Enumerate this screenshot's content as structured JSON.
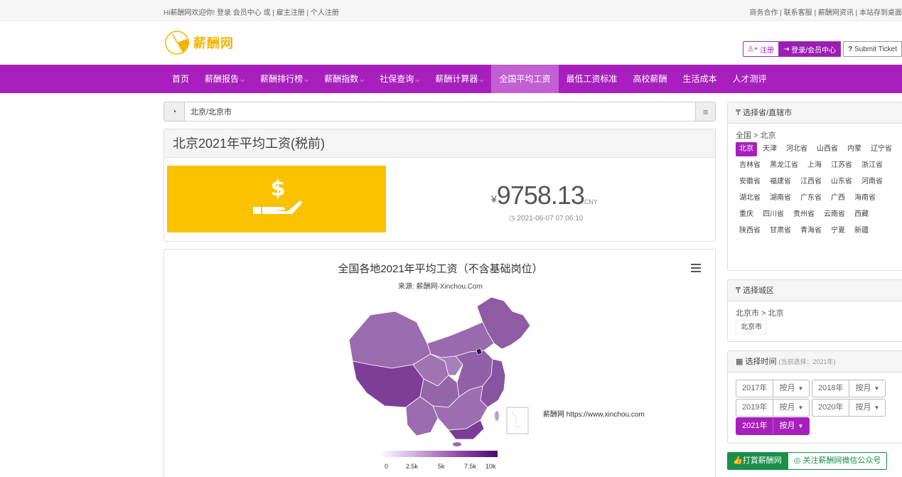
{
  "topbar": {
    "welcome": "Hi薪酬网欢迎你!",
    "login": "登录",
    "member_center": "会员中心",
    "or": "或",
    "employer_register": "雇主注册",
    "personal_register": "个人注册",
    "right_links": [
      "商务合作",
      "联系客服",
      "薪酬网资讯",
      "本站存到桌面"
    ]
  },
  "header": {
    "brand": "薪酬网",
    "register": "注册",
    "login_center": "登录/会员中心",
    "ticket": "Submit Ticket"
  },
  "nav": {
    "items": [
      {
        "label": "首页",
        "dropdown": false
      },
      {
        "label": "薪酬报告",
        "dropdown": true
      },
      {
        "label": "薪酬排行榜",
        "dropdown": true
      },
      {
        "label": "薪酬指数",
        "dropdown": true
      },
      {
        "label": "社保查询",
        "dropdown": true
      },
      {
        "label": "薪酬计算器",
        "dropdown": true
      },
      {
        "label": "全国平均工资",
        "dropdown": false,
        "active": true
      },
      {
        "label": "最低工资标准",
        "dropdown": false
      },
      {
        "label": "高校薪酬",
        "dropdown": false
      },
      {
        "label": "生活成本",
        "dropdown": false
      },
      {
        "label": "人才测评",
        "dropdown": false
      }
    ],
    "caret": "⌵"
  },
  "location": {
    "path": "北京/北京市"
  },
  "salary": {
    "title": "北京2021年平均工资(税前)",
    "currency_symbol": "¥",
    "amount": "9758.13",
    "unit": "CNY",
    "timestamp": "2021-06-07 07:06:10"
  },
  "chart_data": {
    "type": "heatmap",
    "title": "全国各地2021年平均工资（不含基础岗位）",
    "subtitle": "来源: 薪酬网-Xinchou.Com",
    "credit": "薪酬网 https://www.xinchou.com",
    "color_axis": {
      "min": 0,
      "max": 10000,
      "ticks": [
        "0",
        "2.5k",
        "5k",
        "7.5k",
        "10k"
      ],
      "colors": [
        "#fbf7fc",
        "#4a0d6b"
      ]
    }
  },
  "sidebar": {
    "province": {
      "heading": "选择省/直辖市",
      "crumb": "全国 > 北京",
      "items": [
        "北京",
        "天津",
        "河北省",
        "山西省",
        "内蒙",
        "辽宁省",
        "吉林省",
        "黑龙江省",
        "上海",
        "江苏省",
        "浙江省",
        "安徽省",
        "福建省",
        "江西省",
        "山东省",
        "河南省",
        "湖北省",
        "湖南省",
        "广东省",
        "广西",
        "海南省",
        "重庆",
        "四川省",
        "贵州省",
        "云南省",
        "西藏",
        "陕西省",
        "甘肃省",
        "青海省",
        "宁夏",
        "新疆"
      ],
      "selected": "北京"
    },
    "city": {
      "heading": "选择城区",
      "crumb": "北京市 > 北京",
      "items": [
        "北京市"
      ]
    },
    "time": {
      "heading": "选择时间",
      "hint": "(当前选择：2021年)",
      "years": [
        {
          "year": "2017年",
          "mode": "按月"
        },
        {
          "year": "2018年",
          "mode": "按月"
        },
        {
          "year": "2019年",
          "mode": "按月"
        },
        {
          "year": "2020年",
          "mode": "按月"
        },
        {
          "year": "2021年",
          "mode": "按月",
          "active": true
        }
      ]
    },
    "donate": "打賞薪酬网",
    "wechat": "关注薪酬网微信公众号"
  }
}
